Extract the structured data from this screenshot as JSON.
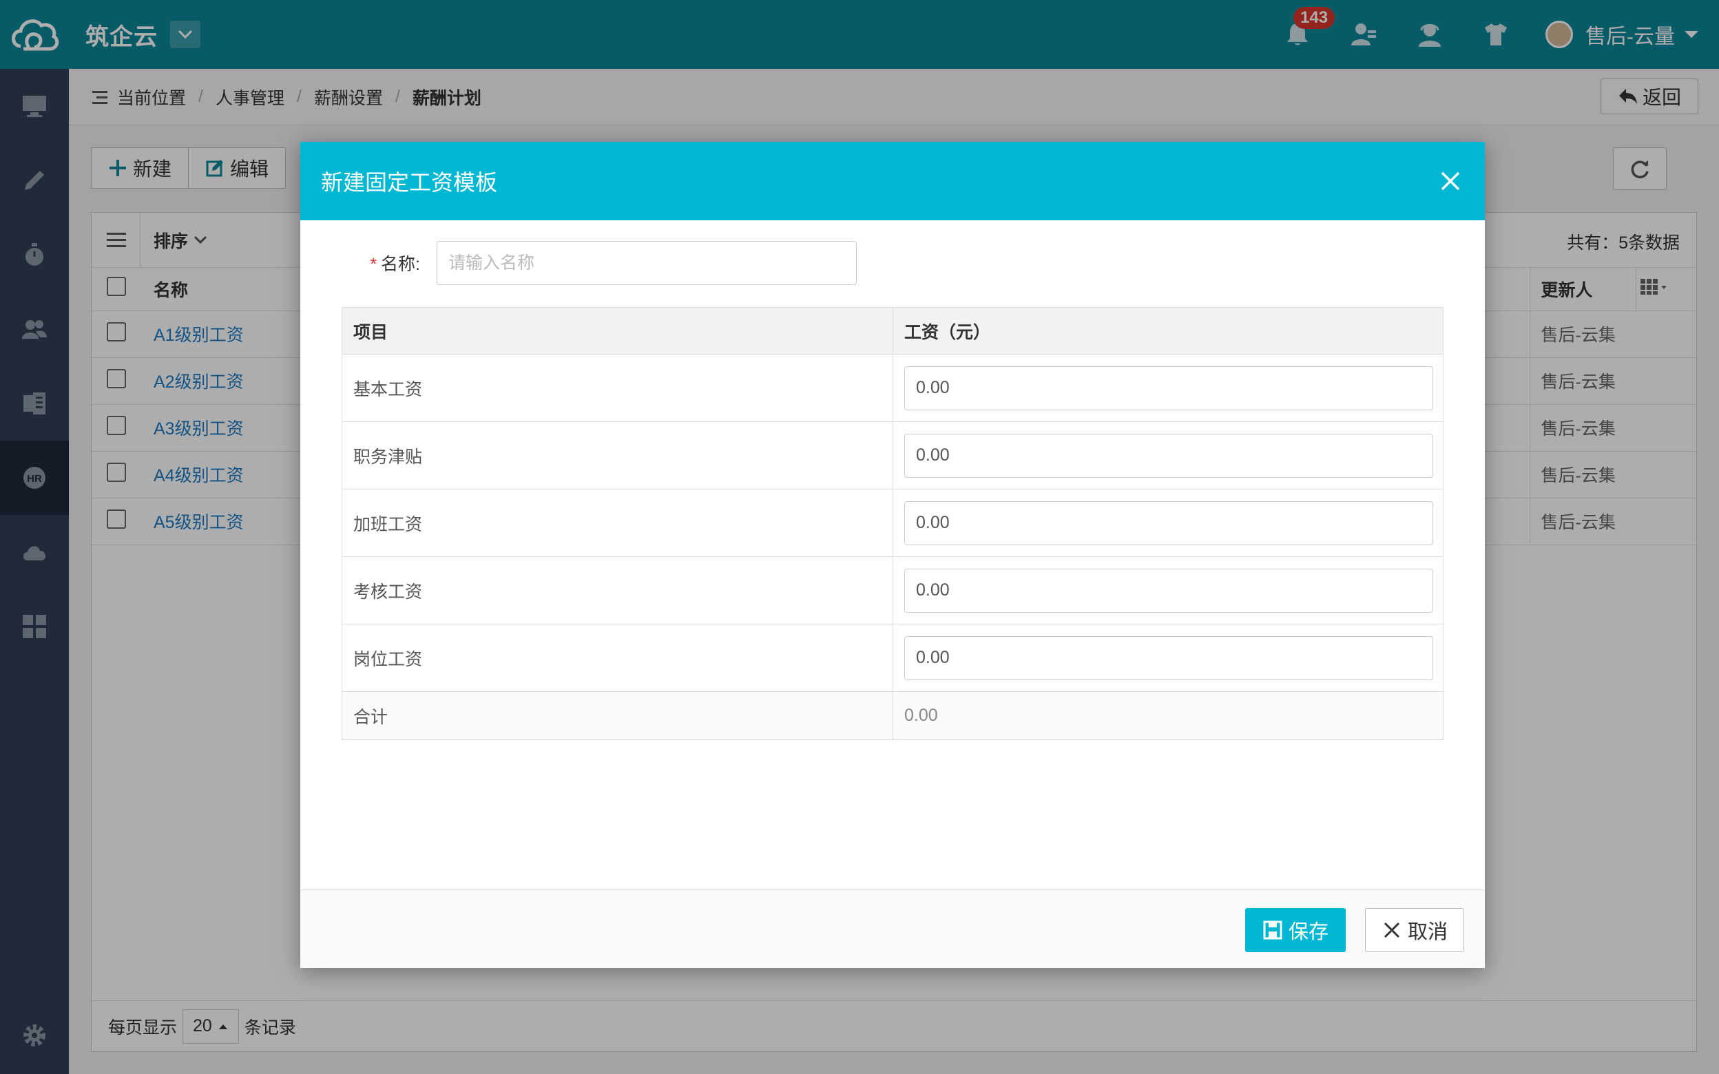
{
  "app": {
    "brand": "筑企云",
    "notification_count": "143",
    "user_name": "售后-云量"
  },
  "breadcrumb": {
    "prefix": "当前位置",
    "items": [
      "人事管理",
      "薪酬设置",
      "薪酬计划"
    ],
    "back_label": "返回"
  },
  "toolbar": {
    "new_label": "新建",
    "edit_label": "编辑"
  },
  "list": {
    "sort_label": "排序",
    "total_text": "共有：5条数据",
    "columns": {
      "name": "名称",
      "updater": "更新人"
    },
    "rows": [
      {
        "name": "A1级别工资",
        "updater": "售后-云集"
      },
      {
        "name": "A2级别工资",
        "updater": "售后-云集"
      },
      {
        "name": "A3级别工资",
        "updater": "售后-云集"
      },
      {
        "name": "A4级别工资",
        "updater": "售后-云集"
      },
      {
        "name": "A5级别工资",
        "updater": "售后-云集"
      }
    ],
    "pager": {
      "prefix": "每页显示",
      "page_size": "20",
      "suffix": "条记录"
    }
  },
  "modal": {
    "title": "新建固定工资模板",
    "name_label": "名称:",
    "name_placeholder": "请输入名称",
    "table_headers": {
      "item": "项目",
      "salary": "工资（元）"
    },
    "rows": [
      {
        "label": "基本工资",
        "value": "0.00"
      },
      {
        "label": "职务津贴",
        "value": "0.00"
      },
      {
        "label": "加班工资",
        "value": "0.00"
      },
      {
        "label": "考核工资",
        "value": "0.00"
      },
      {
        "label": "岗位工资",
        "value": "0.00"
      }
    ],
    "total_label": "合计",
    "total_value": "0.00",
    "save_label": "保存",
    "cancel_label": "取消"
  },
  "colors": {
    "topbar": "#0b8699",
    "sidebar": "#2f4052",
    "modal_header": "#00b8d4",
    "badge": "#d9362b",
    "link": "#1e7bc2"
  }
}
